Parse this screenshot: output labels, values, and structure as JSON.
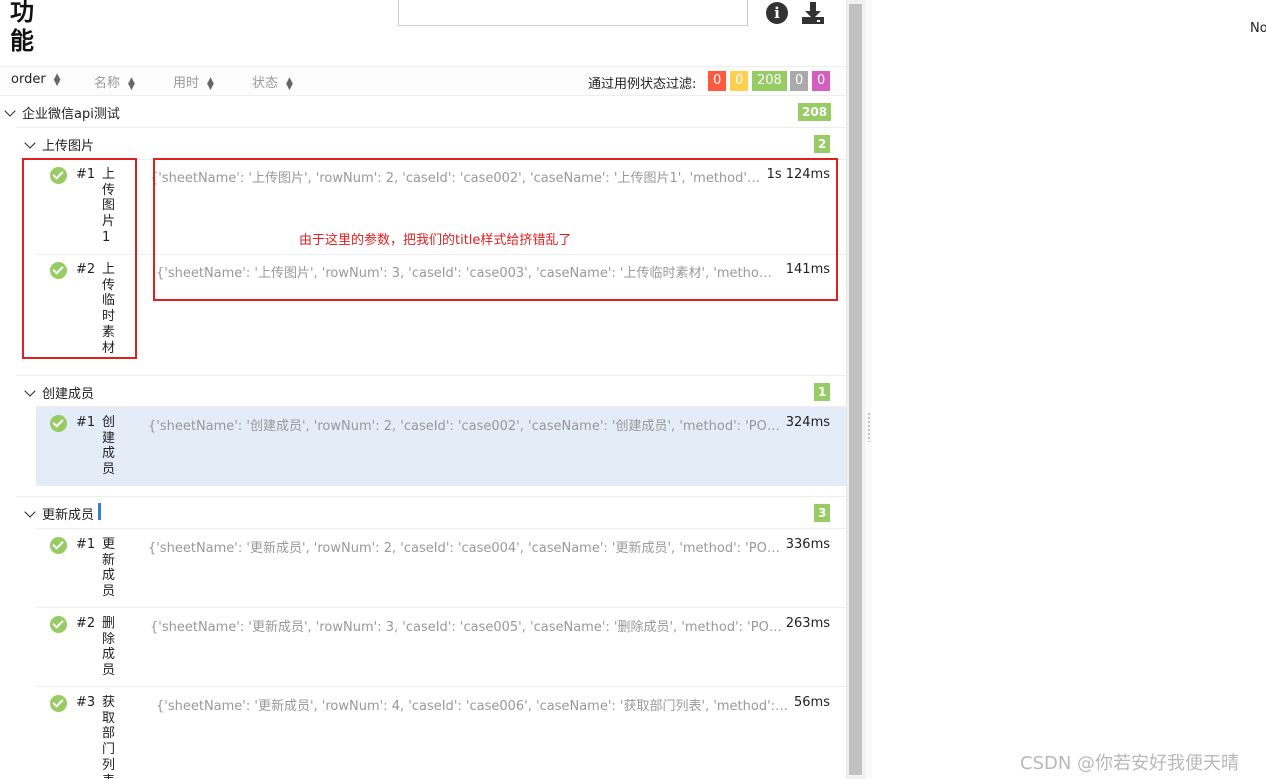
{
  "header": {
    "title": "功能",
    "search": {
      "value": "",
      "placeholder": ""
    },
    "info_icon": "info-icon",
    "download_icon": "download-icon"
  },
  "toolbar": {
    "sorts": [
      {
        "label": "order",
        "active": true
      },
      {
        "label": "名称",
        "active": false
      },
      {
        "label": "用时",
        "active": false
      },
      {
        "label": "状态",
        "active": false
      }
    ],
    "filter_label": "通过用例状态过滤:",
    "filter_badges": [
      {
        "value": "0",
        "color": "#fd5a3e"
      },
      {
        "value": "0",
        "color": "#ffd050"
      },
      {
        "value": "208",
        "color": "#97cc64"
      },
      {
        "value": "0",
        "color": "#aaaaaa"
      },
      {
        "value": "0",
        "color": "#d35ebe"
      }
    ]
  },
  "tree": {
    "suite": {
      "name": "企业微信api测试",
      "count": "208"
    },
    "groups": [
      {
        "name": "上传图片",
        "count": "2",
        "cases": [
          {
            "num": "#1",
            "name": "上传图片1",
            "params": "{'sheetName': '上传图片', 'rowNum': 2, 'caseId': 'case002', 'caseName': '上传图片1', 'method': 'POST', 'url': 'https://qyapi.weixin.qq.com/cgi-bin/media/uploadimg'}",
            "duration": "1s 124ms"
          },
          {
            "num": "#2",
            "name": "上传临时素材",
            "params": "{'sheetName': '上传图片', 'rowNum': 3, 'caseId': 'case003', 'caseName': '上传临时素材', 'method': 'POST', 'url': 'https://qyapi.weixin.qq.com/cgi-bin/media/upload'}",
            "duration": "141ms"
          }
        ]
      },
      {
        "name": "创建成员",
        "count": "1",
        "cases": [
          {
            "num": "#1",
            "name": "创建成员",
            "params": "{'sheetName': '创建成员', 'rowNum': 2, 'caseId': 'case002', 'caseName': '创建成员', 'method': 'POST', 'url': 'https://qyapi.weixin.qq.com/cgi-bin/user/create'}",
            "duration": "324ms"
          }
        ]
      },
      {
        "name": "更新成员",
        "count": "3",
        "cases": [
          {
            "num": "#1",
            "name": "更新成员",
            "params": "{'sheetName': '更新成员', 'rowNum': 2, 'caseId': 'case004', 'caseName': '更新成员', 'method': 'POST', 'url': 'https://qyapi.weixin.qq.com/cgi-bin/user/update'}",
            "duration": "336ms"
          },
          {
            "num": "#2",
            "name": "删除成员",
            "params": "{'sheetName': '更新成员', 'rowNum': 3, 'caseId': 'case005', 'caseName': '删除成员', 'method': 'POST', 'url': 'https://qyapi.weixin.qq.com/cgi-bin/user/delete'}",
            "duration": "263ms"
          },
          {
            "num": "#3",
            "name": "获取部门列表",
            "params": "{'sheetName': '更新成员', 'rowNum': 4, 'caseId': 'case006', 'caseName': '获取部门列表', 'method': 'POST', 'url': 'https://qyapi.weixin.qq.com/cgi-bin/department/list'}",
            "duration": "56ms"
          }
        ]
      }
    ]
  },
  "annotation": "由于这里的参数，把我们的title样式给挤错乱了",
  "right_pane": {
    "text": "No"
  },
  "watermark": "CSDN @你若安好我便天晴"
}
